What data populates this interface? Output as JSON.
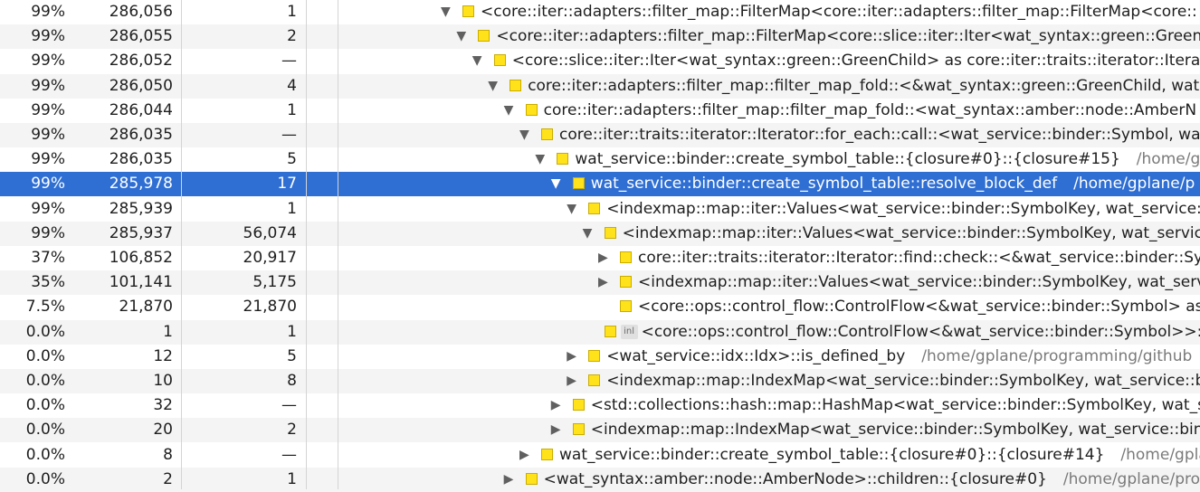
{
  "rows": [
    {
      "pct": "99%",
      "incl": "286,056",
      "self": "1",
      "depth": 0,
      "arrow": "▼",
      "name": "<core::iter::adapters::filter_map::FilterMap<core::iter::adapters::filter_map::FilterMap<core::",
      "path": ""
    },
    {
      "pct": "99%",
      "incl": "286,055",
      "self": "2",
      "depth": 1,
      "arrow": "▼",
      "name": "<core::iter::adapters::filter_map::FilterMap<core::slice::iter::Iter<wat_syntax::green::Green",
      "path": ""
    },
    {
      "pct": "99%",
      "incl": "286,052",
      "self": "—",
      "depth": 2,
      "arrow": "▼",
      "name": "<core::slice::iter::Iter<wat_syntax::green::GreenChild> as core::iter::traits::iterator::Iterat",
      "path": ""
    },
    {
      "pct": "99%",
      "incl": "286,050",
      "self": "4",
      "depth": 3,
      "arrow": "▼",
      "name": "core::iter::adapters::filter_map::filter_map_fold::<&wat_syntax::green::GreenChild, wat",
      "path": ""
    },
    {
      "pct": "99%",
      "incl": "286,044",
      "self": "1",
      "depth": 4,
      "arrow": "▼",
      "name": "core::iter::adapters::filter_map::filter_map_fold::<wat_syntax::amber::node::AmberN",
      "path": ""
    },
    {
      "pct": "99%",
      "incl": "286,035",
      "self": "—",
      "depth": 5,
      "arrow": "▼",
      "name": "core::iter::traits::iterator::Iterator::for_each::call::<wat_service::binder::Symbol, wa",
      "path": ""
    },
    {
      "pct": "99%",
      "incl": "286,035",
      "self": "5",
      "depth": 6,
      "arrow": "▼",
      "name": "wat_service::binder::create_symbol_table::{closure#0}::{closure#15}",
      "path": "/home/gp"
    },
    {
      "pct": "99%",
      "incl": "285,978",
      "self": "17",
      "depth": 7,
      "arrow": "▼",
      "name": "wat_service::binder::create_symbol_table::resolve_block_def",
      "path": "/home/gplane/p",
      "selected": true
    },
    {
      "pct": "99%",
      "incl": "285,939",
      "self": "1",
      "depth": 8,
      "arrow": "▼",
      "name": "<indexmap::map::iter::Values<wat_service::binder::SymbolKey, wat_service::",
      "path": ""
    },
    {
      "pct": "99%",
      "incl": "285,937",
      "self": "56,074",
      "depth": 9,
      "arrow": "▼",
      "name": "<indexmap::map::iter::Values<wat_service::binder::SymbolKey, wat_servic",
      "path": ""
    },
    {
      "pct": "37%",
      "incl": "106,852",
      "self": "20,917",
      "depth": 10,
      "arrow": "▶",
      "name": "core::iter::traits::iterator::Iterator::find::check::<&wat_service::binder::Sy",
      "path": ""
    },
    {
      "pct": "35%",
      "incl": "101,141",
      "self": "5,175",
      "depth": 10,
      "arrow": "▶",
      "name": "<indexmap::map::iter::Values<wat_service::binder::SymbolKey, wat_serv",
      "path": ""
    },
    {
      "pct": "7.5%",
      "incl": "21,870",
      "self": "21,870",
      "depth": 10,
      "arrow": "",
      "name": "<core::ops::control_flow::ControlFlow<&wat_service::binder::Symbol> as",
      "path": ""
    },
    {
      "pct": "0.0%",
      "incl": "1",
      "self": "1",
      "depth": 9,
      "arrow": "",
      "inline": true,
      "inline_label": "inl",
      "name": "<core::ops::control_flow::ControlFlow<&wat_service::binder::Symbol>>::",
      "path": ""
    },
    {
      "pct": "0.0%",
      "incl": "12",
      "self": "5",
      "depth": 8,
      "arrow": "▶",
      "name": "<wat_service::idx::Idx>::is_defined_by",
      "path": "/home/gplane/programming/github"
    },
    {
      "pct": "0.0%",
      "incl": "10",
      "self": "8",
      "depth": 8,
      "arrow": "▶",
      "name": "<indexmap::map::IndexMap<wat_service::binder::SymbolKey, wat_service::b",
      "path": ""
    },
    {
      "pct": "0.0%",
      "incl": "32",
      "self": "—",
      "depth": 7,
      "arrow": "▶",
      "name": "<std::collections::hash::map::HashMap<wat_service::binder::SymbolKey, wat_s",
      "path": ""
    },
    {
      "pct": "0.0%",
      "incl": "20",
      "self": "2",
      "depth": 7,
      "arrow": "▶",
      "name": "<indexmap::map::IndexMap<wat_service::binder::SymbolKey, wat_service::bin",
      "path": ""
    },
    {
      "pct": "0.0%",
      "incl": "8",
      "self": "—",
      "depth": 5,
      "arrow": "▶",
      "name": "wat_service::binder::create_symbol_table::{closure#0}::{closure#14}",
      "path": "/home/gpla"
    },
    {
      "pct": "0.0%",
      "incl": "2",
      "self": "1",
      "depth": 4,
      "arrow": "▶",
      "name": "<wat_syntax::amber::node::AmberNode>::children::{closure#0}",
      "path": "/home/gplane/pro"
    }
  ],
  "colors": {
    "selection": "#2f6fd3",
    "alt_row": "#f4f4f4",
    "function_marker": "#ffe21a"
  },
  "icons": {
    "expanded": "arrow-down-icon",
    "collapsed": "arrow-right-icon",
    "function": "function-square-icon",
    "inline": "inline-badge-icon"
  }
}
